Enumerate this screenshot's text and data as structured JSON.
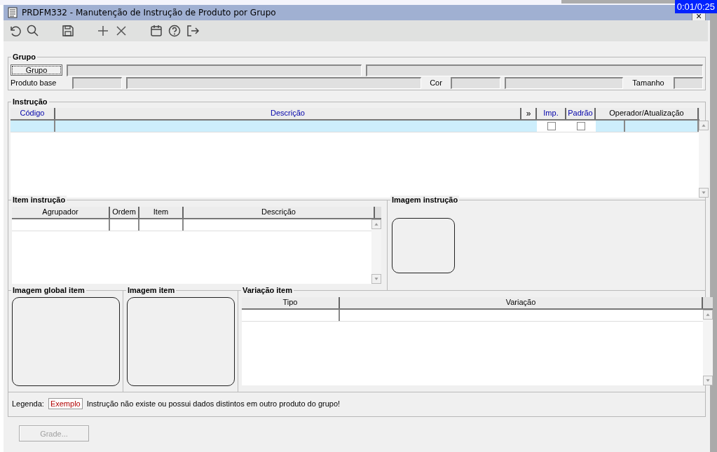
{
  "window": {
    "title": "PRDFM332 - Manutenção de Instrução de Produto por Grupo",
    "close_symbol": "×"
  },
  "player_time": "0:01/0:25",
  "toolbar": [
    {
      "kind": "undo"
    },
    {
      "kind": "search"
    },
    {
      "kind": "save"
    },
    {
      "kind": "add"
    },
    {
      "kind": "delete"
    },
    {
      "kind": "calendar"
    },
    {
      "kind": "help"
    },
    {
      "kind": "exit"
    }
  ],
  "grupo": {
    "title": "Grupo",
    "button": "Grupo",
    "product_label": "Produto base",
    "color_label": "Cor",
    "size_label": "Tamanho"
  },
  "instrucao": {
    "title": "Instrução",
    "expand_button": "»",
    "columns": [
      {
        "label": "Código",
        "highlighted": true
      },
      {
        "label": "Descrição",
        "highlighted": true
      },
      {
        "label": "Imp.",
        "highlighted": true
      },
      {
        "label": "Padrão",
        "highlighted": true
      },
      {
        "label": "Operador/Atualização",
        "highlighted": false
      }
    ],
    "rows": [
      {
        "selected": true,
        "imp": false,
        "padrao": false
      }
    ]
  },
  "item_instrucao": {
    "title": "Item instrução",
    "columns": [
      "Agrupador",
      "Ordem",
      "Item",
      "Descrição"
    ]
  },
  "imagem_instrucao": {
    "title": "Imagem instrução"
  },
  "imagem_global_item": {
    "title": "Imagem global item"
  },
  "imagem_item": {
    "title": "Imagem item"
  },
  "variacao_item": {
    "title": "Variação item",
    "columns": [
      "Tipo",
      "Variação"
    ]
  },
  "legend": {
    "label": "Legenda:",
    "sample": "Exemplo",
    "text": "Instrução não existe ou possui dados distintos em outro produto do grupo!"
  },
  "grade_button": {
    "label": "Grade...",
    "disabled": true
  }
}
